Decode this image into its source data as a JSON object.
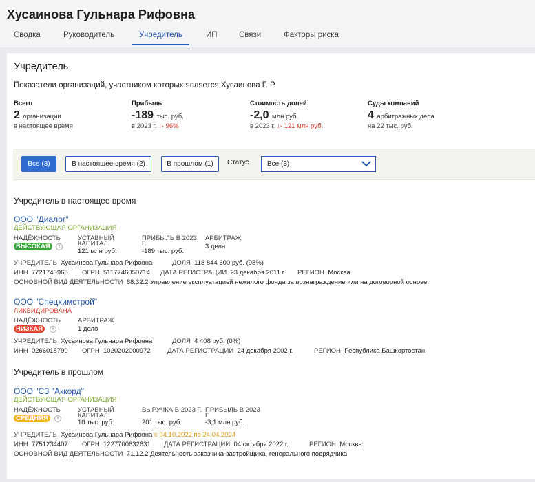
{
  "page": {
    "title": "Хусаинова Гульнара Рифовна"
  },
  "tabs": [
    {
      "label": "Сводка"
    },
    {
      "label": "Руководитель"
    },
    {
      "label": "Учредитель"
    },
    {
      "label": "ИП"
    },
    {
      "label": "Связи"
    },
    {
      "label": "Факторы риска"
    }
  ],
  "section": {
    "title": "Учредитель",
    "subtitle": "Показатели организаций, участником которых является Хусаинова Г. Р."
  },
  "kpis": {
    "total": {
      "label": "Всего",
      "value": "2",
      "unit": "организации",
      "note": "в настоящее время"
    },
    "profit": {
      "label": "Прибыль",
      "value": "-189",
      "unit": "тыс. руб.",
      "note": "в 2023 г.",
      "delta": "↓- 96%"
    },
    "shares": {
      "label": "Стоимость долей",
      "value": "-2,0",
      "unit": "млн руб.",
      "note": "в 2023 г.",
      "delta": "↓- 121 млн руб."
    },
    "courts": {
      "label": "Суды компаний",
      "value": "4",
      "unit": "арбитражных дела",
      "note": "на 22 тыс. руб."
    }
  },
  "filters": {
    "all": "Все (3)",
    "current": "В настоящее время (2)",
    "past": "В прошлом (1)",
    "status_label": "Статус",
    "status_value": "Все (3)"
  },
  "current_title": "Учредитель в настоящее время",
  "past_title": "Учредитель в прошлом",
  "orgs": {
    "dialog": {
      "name": "ООО \"Диалог\"",
      "status": "ДЕЙСТВУЮЩАЯ ОРГАНИЗАЦИЯ",
      "rel_label": "НАДЁЖНОСТЬ",
      "rel_badge": "ВЫСОКАЯ",
      "cap_label": "УСТАВНЫЙ КАПИТАЛ",
      "cap_value": "121 млн руб.",
      "profit_label": "ПРИБЫЛЬ В 2023 Г.",
      "profit_value": "-189 тыс. руб.",
      "arb_label": "АРБИТРАЖ",
      "arb_value": "3 дела",
      "founder_label": "УЧРЕДИТЕЛЬ",
      "founder_value": "Хусаинова Гульнара Рифовна",
      "share_label": "ДОЛЯ",
      "share_value": "118 844 600 руб. (98%)",
      "inn_label": "ИНН",
      "inn_value": "7721745965",
      "ogrn_label": "ОГРН",
      "ogrn_value": "5117746050714",
      "reg_label": "ДАТА РЕГИСТРАЦИИ",
      "reg_value": "23 декабря 2011 г.",
      "region_label": "РЕГИОН",
      "region_value": "Москва",
      "activity_label": "ОСНОВНОЙ ВИД ДЕЯТЕЛЬНОСТИ",
      "activity_value": "68.32.2 Управление эксплуатацией нежилого фонда за вознаграждение или на договорной основе"
    },
    "spec": {
      "name": "ООО \"Спецхимстрой\"",
      "status": "ЛИКВИДИРОВАНА",
      "rel_label": "НАДЁЖНОСТЬ",
      "rel_badge": "НИЗКАЯ",
      "arb_label": "АРБИТРАЖ",
      "arb_value": "1 дело",
      "founder_label": "УЧРЕДИТЕЛЬ",
      "founder_value": "Хусаинова Гульнара Рифовна",
      "share_label": "ДОЛЯ",
      "share_value": "4 408 руб. (0%)",
      "inn_label": "ИНН",
      "inn_value": "0266018790",
      "ogrn_label": "ОГРН",
      "ogrn_value": "1020202000972",
      "reg_label": "ДАТА РЕГИСТРАЦИИ",
      "reg_value": "24 декабря 2002 г.",
      "region_label": "РЕГИОН",
      "region_value": "Республика Башкортостан"
    },
    "akkord": {
      "name": "ООО \"СЗ \"Аккорд\"",
      "status": "ДЕЙСТВУЮЩАЯ ОРГАНИЗАЦИЯ",
      "rel_label": "НАДЁЖНОСТЬ",
      "rel_badge": "СРЕДНЯЯ",
      "cap_label": "УСТАВНЫЙ КАПИТАЛ",
      "cap_value": "10 тыс. руб.",
      "rev_label": "ВЫРУЧКА В 2023 Г.",
      "rev_value": "201 тыс. руб.",
      "profit_label": "ПРИБЫЛЬ В 2023 Г.",
      "profit_value": "-3,1 млн руб.",
      "founder_label": "УЧРЕДИТЕЛЬ",
      "founder_value": "Хусаинова Гульнара Рифовна",
      "founder_period": "с 04.10.2022 по 24.04.2024",
      "inn_label": "ИНН",
      "inn_value": "7751234407",
      "ogrn_label": "ОГРН",
      "ogrn_value": "1227700632631",
      "reg_label": "ДАТА РЕГИСТРАЦИИ",
      "reg_value": "04 октября 2022 г.",
      "region_label": "РЕГИОН",
      "region_value": "Москва",
      "activity_label": "ОСНОВНОЙ ВИД ДЕЯТЕЛЬНОСТИ",
      "activity_value": "71.12.2 Деятельность заказчика-застройщика, генерального подрядчика"
    }
  },
  "icons": {
    "info": "info-icon",
    "chevron": "chevron-down-icon",
    "arrow": "arrow-down-icon"
  },
  "colors": {
    "accent": "#2f6bd0",
    "link": "#2456a6",
    "negative": "#d23c2c",
    "active_status": "#7aa836",
    "period": "#e09a10"
  }
}
